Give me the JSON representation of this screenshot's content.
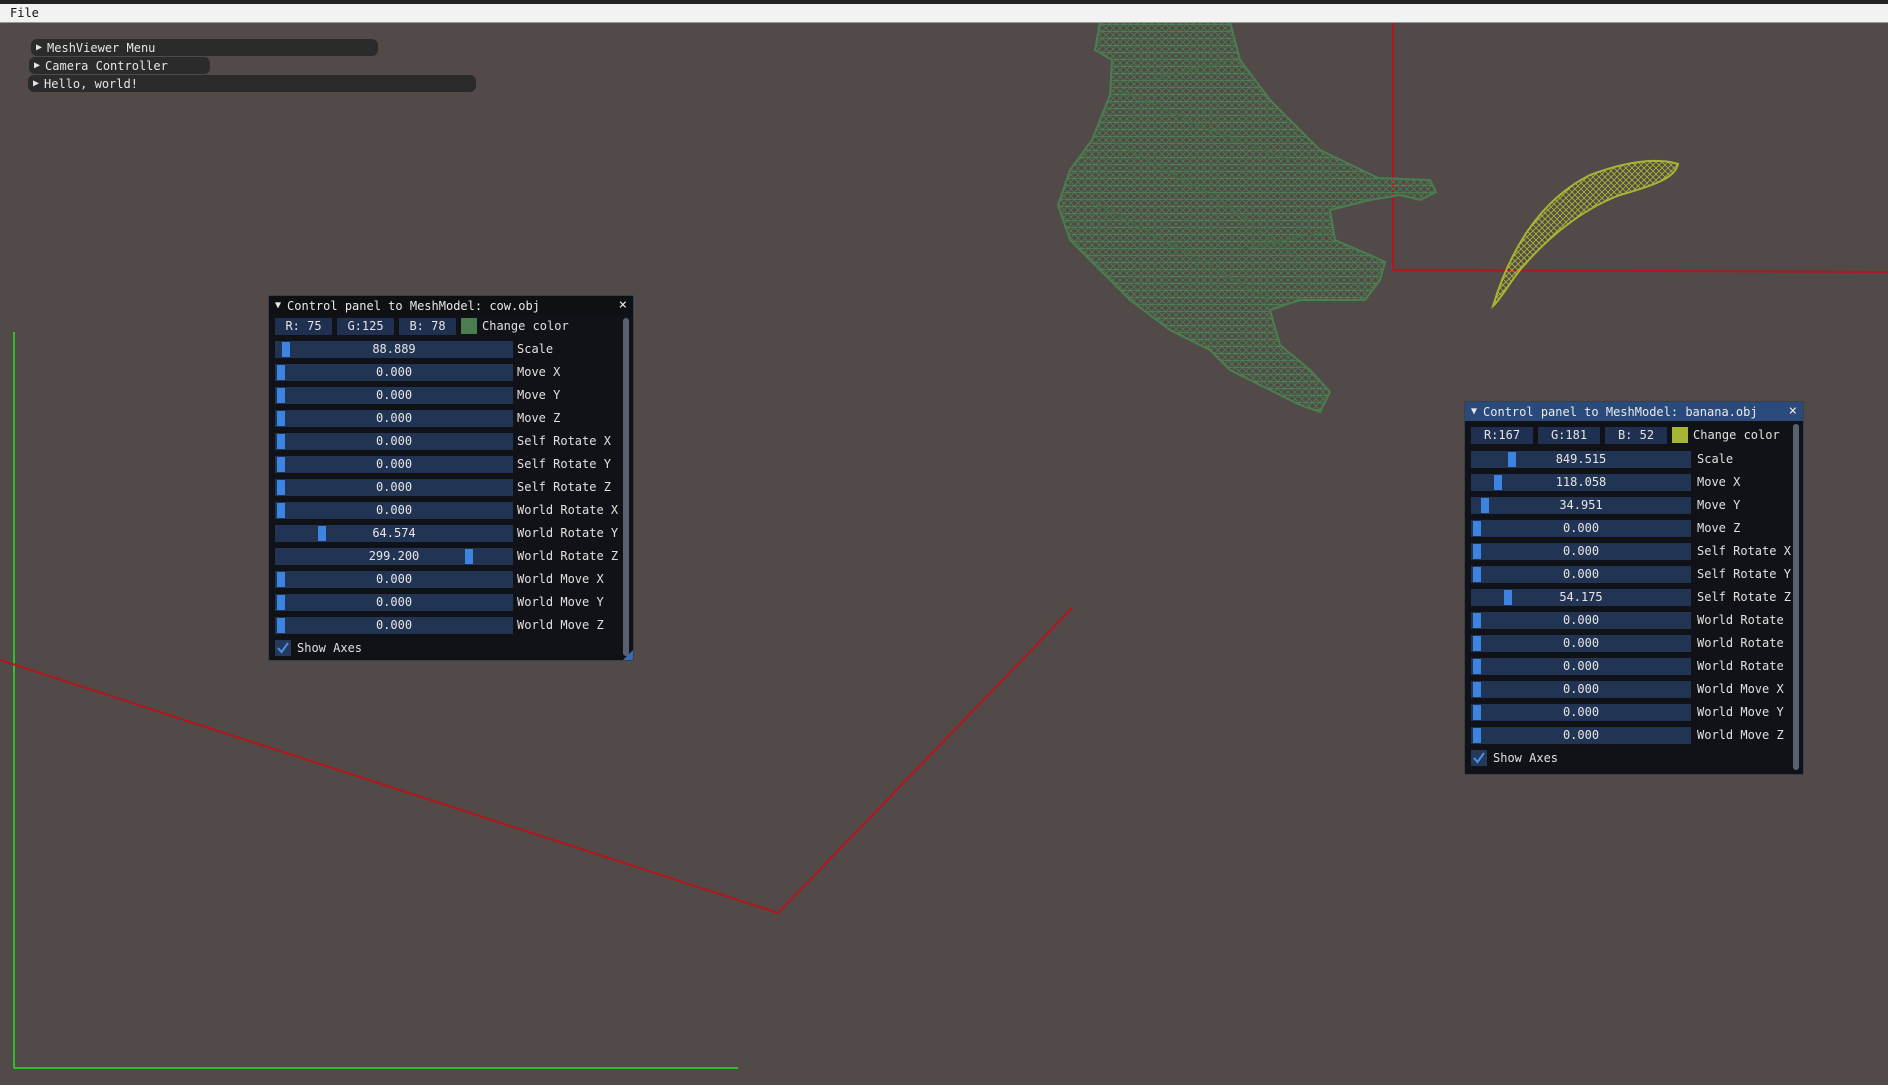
{
  "menubar": {
    "file_label": "File"
  },
  "windows": [
    {
      "title": "MeshViewer Menu"
    },
    {
      "title": "Camera Controller"
    },
    {
      "title": "Hello, world!"
    }
  ],
  "cow_panel": {
    "title": "Control panel to MeshModel: cow.obj",
    "close_icon": "×",
    "r_label": "R: 75",
    "g_label": "G:125",
    "b_label": "B: 78",
    "color_hex": "#4b7d4e",
    "change_color_label": "Change color",
    "sliders": [
      {
        "value": "88.889",
        "label": "Scale",
        "level": 0.02
      },
      {
        "value": "0.000",
        "label": "Move X",
        "level": 0.0
      },
      {
        "value": "0.000",
        "label": "Move Y",
        "level": 0.0
      },
      {
        "value": "0.000",
        "label": "Move Z",
        "level": 0.0
      },
      {
        "value": "0.000",
        "label": "Self Rotate X",
        "level": 0.0
      },
      {
        "value": "0.000",
        "label": "Self Rotate Y",
        "level": 0.0
      },
      {
        "value": "0.000",
        "label": "Self Rotate Z",
        "level": 0.0
      },
      {
        "value": "0.000",
        "label": "World Rotate X",
        "level": 0.0
      },
      {
        "value": "64.574",
        "label": "World Rotate Y",
        "level": 0.18
      },
      {
        "value": "299.200",
        "label": "World Rotate Z",
        "level": 0.83
      },
      {
        "value": "0.000",
        "label": "World Move X",
        "level": 0.0
      },
      {
        "value": "0.000",
        "label": "World Move Y",
        "level": 0.0
      },
      {
        "value": "0.000",
        "label": "World Move Z",
        "level": 0.0
      }
    ],
    "show_axes_label": "Show Axes",
    "show_axes_checked": true
  },
  "banana_panel": {
    "title": "Control panel to MeshModel: banana.obj",
    "close_icon": "×",
    "r_label": "R:167",
    "g_label": "G:181",
    "b_label": "B: 52",
    "color_hex": "#a7b534",
    "change_color_label": "Change color",
    "sliders": [
      {
        "value": "849.515",
        "label": "Scale",
        "level": 0.17
      },
      {
        "value": "118.058",
        "label": "Move X",
        "level": 0.1
      },
      {
        "value": "34.951",
        "label": "Move Y",
        "level": 0.04
      },
      {
        "value": "0.000",
        "label": "Move Z",
        "level": 0.0
      },
      {
        "value": "0.000",
        "label": "Self Rotate X",
        "level": 0.0
      },
      {
        "value": "0.000",
        "label": "Self Rotate Y",
        "level": 0.0
      },
      {
        "value": "54.175",
        "label": "Self Rotate Z",
        "level": 0.15
      },
      {
        "value": "0.000",
        "label": "World Rotate",
        "level": 0.0
      },
      {
        "value": "0.000",
        "label": "World Rotate",
        "level": 0.0
      },
      {
        "value": "0.000",
        "label": "World Rotate",
        "level": 0.0
      },
      {
        "value": "0.000",
        "label": "World Move X",
        "level": 0.0
      },
      {
        "value": "0.000",
        "label": "World Move Y",
        "level": 0.0
      },
      {
        "value": "0.000",
        "label": "World Move Z",
        "level": 0.0
      }
    ],
    "show_axes_label": "Show Axes",
    "show_axes_checked": true
  },
  "scene": {
    "background": "#514a49",
    "axis_red": "#b3161a",
    "axis_green": "#2fbf2a",
    "cow_mesh_color": "#4b7d4e",
    "banana_mesh_color": "#a7b534"
  }
}
